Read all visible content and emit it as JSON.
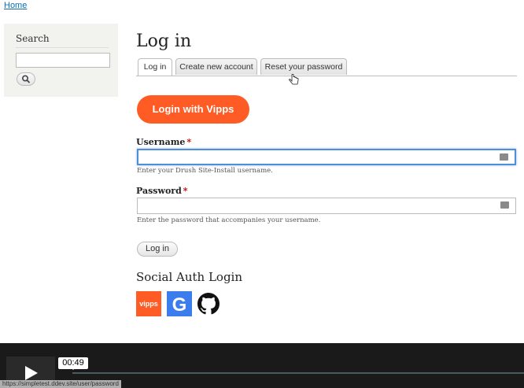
{
  "breadcrumb": {
    "home": "Home"
  },
  "sidebar": {
    "search_title": "Search",
    "search_value": ""
  },
  "page": {
    "title": "Log in"
  },
  "tabs": [
    {
      "label": "Log in",
      "active": true
    },
    {
      "label": "Create new account",
      "active": false
    },
    {
      "label": "Reset your password",
      "active": false
    }
  ],
  "vipps_button": {
    "label": "Login with Vipps"
  },
  "form": {
    "username": {
      "label": "Username",
      "required_mark": "*",
      "value": "",
      "description": "Enter your Drush Site-Install username."
    },
    "password": {
      "label": "Password",
      "required_mark": "*",
      "value": "",
      "description": "Enter the password that accompanies your username."
    },
    "submit_label": "Log in"
  },
  "social": {
    "title": "Social Auth Login",
    "providers": [
      {
        "label": "vipps",
        "icon": "vipps-icon",
        "color": "#ff5b24"
      },
      {
        "label": "G",
        "icon": "google-icon",
        "color": "#3b7ded"
      },
      {
        "label": "",
        "icon": "github-icon",
        "color": "#000000"
      }
    ]
  },
  "player": {
    "time": "00:49",
    "status_url": "https://simpletest.ddev.site/user/password"
  },
  "colors": {
    "accent": "#ff5b24",
    "link": "#0a6eb4",
    "focus": "#4f8fd9"
  }
}
